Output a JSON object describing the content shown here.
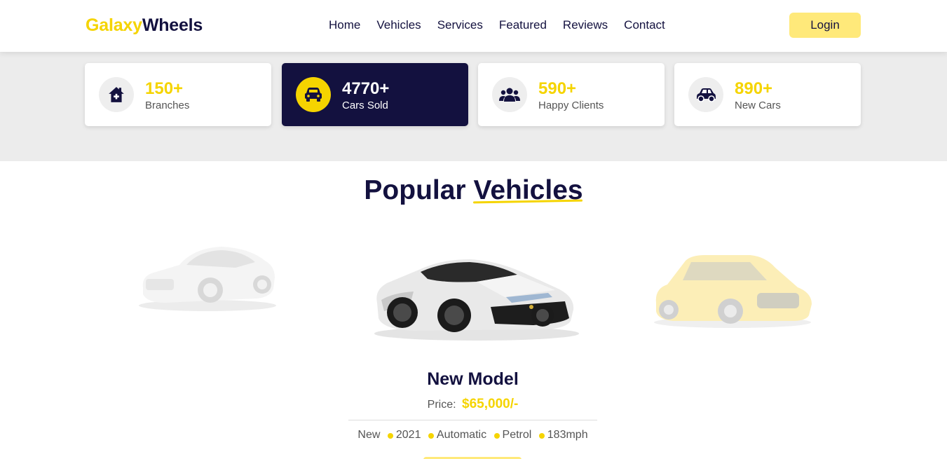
{
  "brand": {
    "part1": "Galaxy",
    "part2": "Wheels"
  },
  "nav": [
    "Home",
    "Vehicles",
    "Services",
    "Featured",
    "Reviews",
    "Contact"
  ],
  "login_label": "Login",
  "stats": [
    {
      "value": "150+",
      "label": "Branches",
      "icon": "home-icon"
    },
    {
      "value": "4770+",
      "label": "Cars Sold",
      "icon": "car-front-icon"
    },
    {
      "value": "590+",
      "label": "Happy Clients",
      "icon": "users-icon"
    },
    {
      "value": "890+",
      "label": "New Cars",
      "icon": "car-side-icon"
    }
  ],
  "section": {
    "title_plain": "Popular",
    "title_underlined": "Vehicles"
  },
  "vehicle": {
    "model": "New Model",
    "price_label": "Price:",
    "price_value": "$65,000/-",
    "specs": [
      "New",
      "2021",
      "Automatic",
      "Petrol",
      "183mph"
    ]
  },
  "colors": {
    "accent": "#f5d400",
    "navy": "#13113f",
    "band": "#ececec",
    "button": "#ffe97a"
  }
}
